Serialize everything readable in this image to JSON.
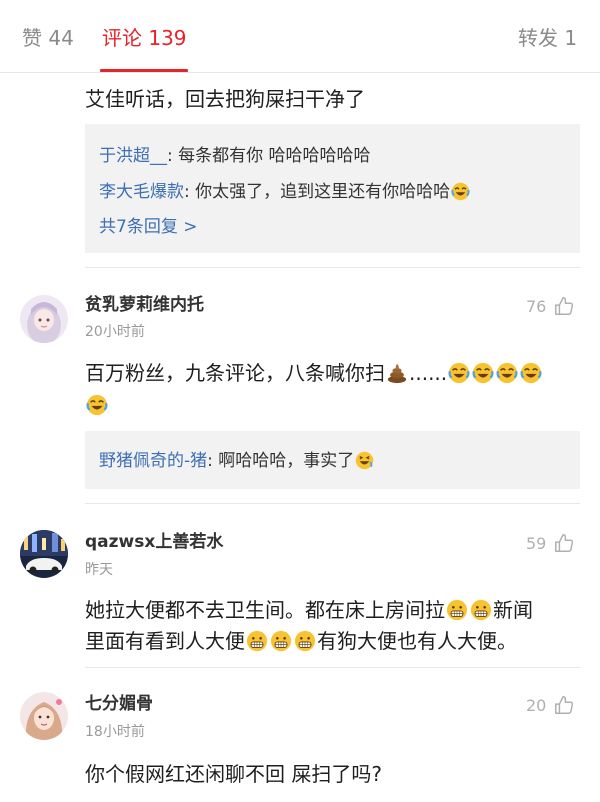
{
  "tabs": [
    {
      "label": "赞 44"
    },
    {
      "label": "评论 139"
    },
    {
      "label": "转发 1"
    }
  ],
  "thread0": {
    "text": "艾佳听话，回去把狗屎扫干净了",
    "replies": [
      {
        "user": "于洪超__",
        "text": ": 每条都有你 哈哈哈哈哈哈"
      },
      {
        "user": "李大毛爆款",
        "text": ": 你太强了，追到这里还有你哈哈哈"
      }
    ],
    "more": "共7条回复 >"
  },
  "comments": [
    {
      "user": "贫乳萝莉维内托",
      "time": "20小时前",
      "likes": "76",
      "line1": "百万粉丝，九条评论，八条喊你扫",
      "ellipsis": "......",
      "reply": {
        "user": "野猪佩奇的-猪",
        "text": ": 啊哈哈哈，事实了"
      }
    },
    {
      "user": "qazwsx上善若水",
      "time": "昨天",
      "likes": "59",
      "line1a": "她拉大便都不去卫生间。都在床上房间拉",
      "line1b": "新闻",
      "line2a": "里面有看到人大便",
      "line2b": "有狗大便也有人大便。"
    },
    {
      "user": "七分媚骨",
      "time": "18小时前",
      "likes": "20",
      "text": "你个假网红还闲聊不回 屎扫了吗?"
    }
  ],
  "colors": {
    "accent": "#e8232b",
    "link": "#3d6fb5",
    "reply_bg": "#f2f2f2"
  },
  "icons": [
    "thumb-up-icon",
    "laughing-tears-emoji",
    "poop-emoji",
    "grin-emoji",
    "laughing-emoji"
  ]
}
